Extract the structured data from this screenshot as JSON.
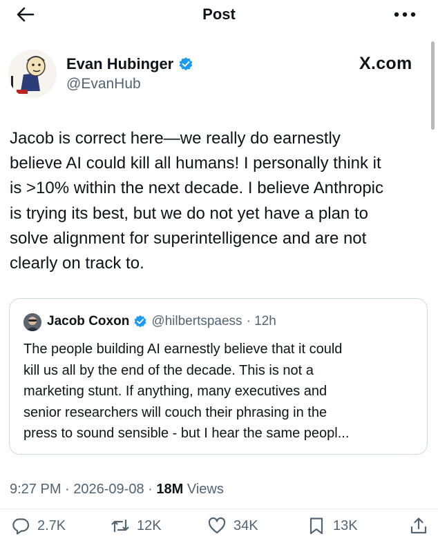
{
  "header": {
    "title": "Post",
    "back_icon": "arrow-left-icon",
    "more_icon": "ellipsis-icon"
  },
  "author": {
    "name": "Evan Hubinger",
    "handle": "@EvanHub",
    "verified": true,
    "platform": "X.com"
  },
  "tweet": {
    "lines": [
      "Jacob is correct here—we really do earnestly",
      "believe AI could kill all humans! I personally think it",
      "is >10% within the next decade. I believe Anthropic",
      "is trying its best, but we do not yet have a plan to",
      "solve alignment for superintelligence and are not",
      "clearly on track to."
    ]
  },
  "quote": {
    "name": "Jacob Coxon",
    "handle": "@hilbertspaess",
    "time": "· 12h",
    "lines": [
      "The people building AI earnestly believe that it could",
      "kill us all by the end of the decade. This is not a",
      "marketing stunt. If anything, many executives and",
      "senior researchers will couch their phrasing in the",
      "press to sound sensible - but I hear the same peopl..."
    ]
  },
  "meta": {
    "time": "9:27 PM",
    "date": "2026-09-08",
    "views_count": "18M",
    "views_label": "Views",
    "sep": "·"
  },
  "actions": {
    "replies": "2.7K",
    "reposts": "12K",
    "likes": "34K",
    "bookmarks": "13K"
  },
  "colors": {
    "verified": "#1d9bf0",
    "secondary_text": "#536471",
    "border": "#cfd9de"
  }
}
